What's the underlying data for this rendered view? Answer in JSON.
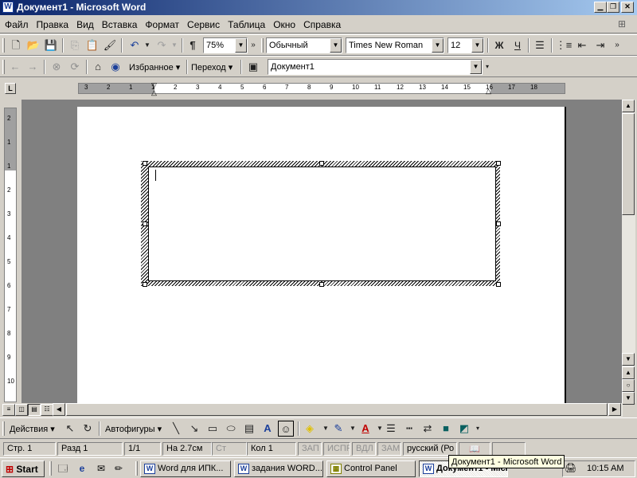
{
  "window": {
    "title": "Документ1 - Microsoft Word",
    "app_icon": "word-icon",
    "controls": [
      "minimize",
      "maximize",
      "close"
    ]
  },
  "menu": {
    "items": [
      "Файл",
      "Правка",
      "Вид",
      "Вставка",
      "Формат",
      "Сервис",
      "Таблица",
      "Окно",
      "Справка"
    ]
  },
  "standard_toolbar": {
    "zoom": "75%",
    "style": "Обычный",
    "font": "Times New Roman",
    "size": "12",
    "bold": "Ж",
    "underline": "Ч"
  },
  "web_toolbar": {
    "favorites": "Избранное",
    "go": "Переход",
    "address": "Документ1"
  },
  "ruler": {
    "corner": "L",
    "h_ticks": [
      "3",
      "2",
      "1",
      "1",
      "2",
      "3",
      "4",
      "5",
      "6",
      "7",
      "8",
      "9",
      "10",
      "11",
      "12",
      "13",
      "14",
      "15",
      "16",
      "17",
      "18"
    ],
    "v_ticks": [
      "2",
      "1",
      "1",
      "2",
      "3",
      "4",
      "5",
      "6",
      "7",
      "8",
      "9",
      "10"
    ]
  },
  "drawing_toolbar": {
    "actions": "Действия",
    "autoshapes": "Автофигуры"
  },
  "status": {
    "page": "Стр. 1",
    "section": "Разд 1",
    "pages": "1/1",
    "at": "На 2.7см",
    "line": "Ст",
    "col": "Кол 1",
    "rec": "ЗАП",
    "trk": "ИСПР",
    "ext": "ВДЛ",
    "ovr": "ЗАМ",
    "lang": "русский (Ро"
  },
  "taskbar": {
    "start": "Start",
    "tasks": [
      {
        "label": "Word для ИПК..."
      },
      {
        "label": "задания WORD..."
      },
      {
        "label": "Control Panel"
      },
      {
        "label": "Документ1 - Microsoft Word"
      }
    ],
    "clock": "10:15 AM",
    "tooltip": "Документ1 - Microsoft Word"
  }
}
